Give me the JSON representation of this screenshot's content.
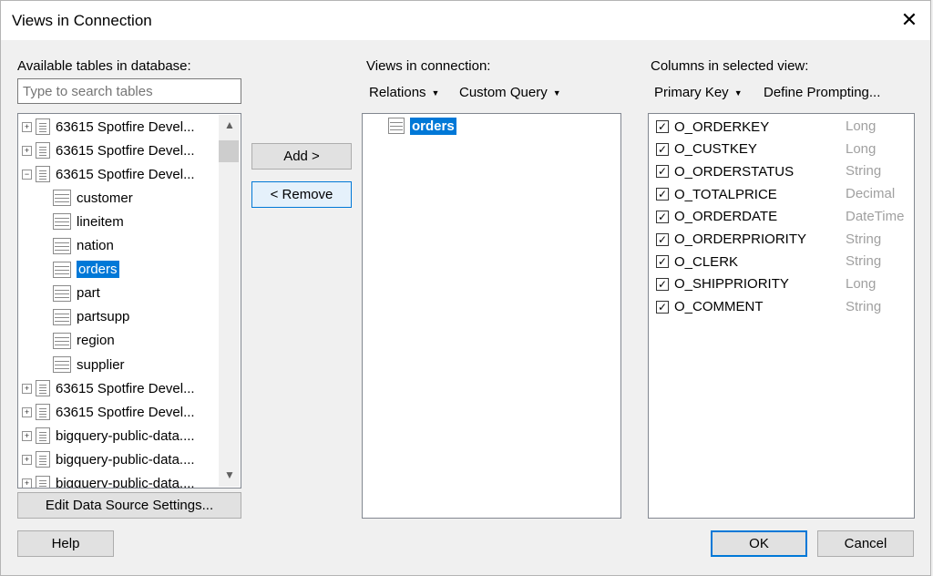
{
  "window": {
    "title": "Views in Connection",
    "close_glyph": "✕"
  },
  "left": {
    "label": "Available tables in database:",
    "search_placeholder": "Type to search tables",
    "tree": [
      {
        "label": "63615 Spotfire Devel...",
        "type": "db",
        "expander": "+"
      },
      {
        "label": "63615 Spotfire Devel...",
        "type": "db",
        "expander": "+"
      },
      {
        "label": "63615 Spotfire Devel...",
        "type": "db",
        "expander": "−"
      },
      {
        "label": "customer",
        "type": "table"
      },
      {
        "label": "lineitem",
        "type": "table"
      },
      {
        "label": "nation",
        "type": "table"
      },
      {
        "label": "orders",
        "type": "table",
        "selected": true
      },
      {
        "label": "part",
        "type": "table"
      },
      {
        "label": "partsupp",
        "type": "table"
      },
      {
        "label": "region",
        "type": "table"
      },
      {
        "label": "supplier",
        "type": "table"
      },
      {
        "label": "63615 Spotfire Devel...",
        "type": "db",
        "expander": "+"
      },
      {
        "label": "63615 Spotfire Devel...",
        "type": "db",
        "expander": "+"
      },
      {
        "label": "bigquery-public-data....",
        "type": "db",
        "expander": "+"
      },
      {
        "label": "bigquery-public-data....",
        "type": "db",
        "expander": "+"
      },
      {
        "label": "bigquery-public-data....",
        "type": "db",
        "expander": "+"
      }
    ],
    "edit_button": "Edit Data Source Settings..."
  },
  "middle": {
    "add_button": "Add >",
    "remove_button": "< Remove",
    "label": "Views in connection:",
    "relations_menu": "Relations",
    "custom_query_menu": "Custom Query",
    "views": [
      {
        "label": "orders",
        "selected": true
      }
    ]
  },
  "right": {
    "label": "Columns in selected view:",
    "primary_key_menu": "Primary Key",
    "define_prompting": "Define Prompting...",
    "columns": [
      {
        "name": "O_ORDERKEY",
        "type": "Long",
        "checked": true
      },
      {
        "name": "O_CUSTKEY",
        "type": "Long",
        "checked": true
      },
      {
        "name": "O_ORDERSTATUS",
        "type": "String",
        "checked": true
      },
      {
        "name": "O_TOTALPRICE",
        "type": "Decimal",
        "checked": true
      },
      {
        "name": "O_ORDERDATE",
        "type": "DateTime",
        "checked": true
      },
      {
        "name": "O_ORDERPRIORITY",
        "type": "String",
        "checked": true
      },
      {
        "name": "O_CLERK",
        "type": "String",
        "checked": true
      },
      {
        "name": "O_SHIPPRIORITY",
        "type": "Long",
        "checked": true
      },
      {
        "name": "O_COMMENT",
        "type": "String",
        "checked": true
      }
    ]
  },
  "footer": {
    "help_button": "Help",
    "ok_button": "OK",
    "cancel_button": "Cancel"
  },
  "colors": {
    "accent": "#0078d7",
    "type_text": "#a0a0a0"
  }
}
